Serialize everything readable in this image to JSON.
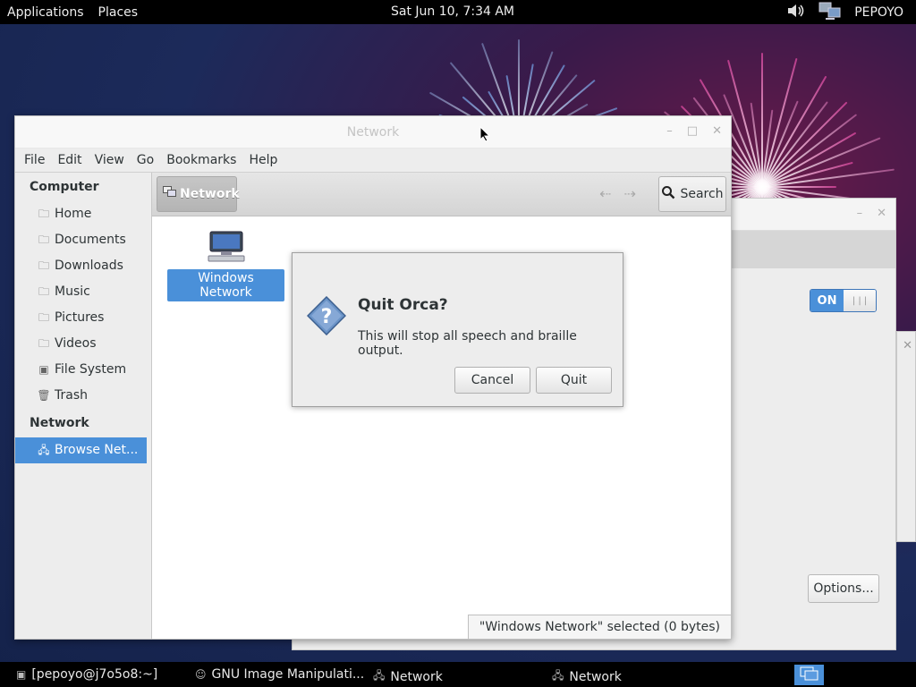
{
  "top_panel": {
    "applications": "Applications",
    "places": "Places",
    "clock": "Sat Jun 10,  7:34 AM",
    "user": "PEPOYO",
    "volume_icon": "speaker-icon",
    "network_icon": "network-icon"
  },
  "main_window": {
    "title": "Network",
    "menu": [
      "File",
      "Edit",
      "View",
      "Go",
      "Bookmarks",
      "Help"
    ],
    "sidebar": {
      "computer_heading": "Computer",
      "computer_items": [
        {
          "label": "Home",
          "icon": "folder-icon"
        },
        {
          "label": "Documents",
          "icon": "folder-icon"
        },
        {
          "label": "Downloads",
          "icon": "folder-icon"
        },
        {
          "label": "Music",
          "icon": "folder-icon"
        },
        {
          "label": "Pictures",
          "icon": "folder-icon"
        },
        {
          "label": "Videos",
          "icon": "folder-icon"
        },
        {
          "label": "File System",
          "icon": "drive-icon"
        },
        {
          "label": "Trash",
          "icon": "trash-icon"
        }
      ],
      "network_heading": "Network",
      "network_items": [
        {
          "label": "Browse Net...",
          "icon": "network-icon",
          "selected": true
        }
      ]
    },
    "toolbar": {
      "location": "Network",
      "search_label": "Search"
    },
    "items": [
      {
        "label": "Windows Network",
        "icon": "windows-network-icon",
        "selected": true
      }
    ],
    "statusbar": "\"Windows Network\" selected (0 bytes)"
  },
  "dialog": {
    "title": "Quit Orca?",
    "message": "This will stop all speech and braille output.",
    "cancel_label": "Cancel",
    "quit_label": "Quit",
    "icon": "question-icon"
  },
  "back_window": {
    "toggle_on": "ON",
    "options_label": "Options..."
  },
  "taskbar": {
    "tasks": [
      {
        "label": "[pepoyo@j7o5o8:~]",
        "icon": "terminal-icon"
      },
      {
        "label": "GNU Image Manipulati...",
        "icon": "gimp-icon"
      },
      {
        "label": "Network",
        "icon": "network-icon"
      },
      {
        "label": "Network",
        "icon": "network-icon"
      }
    ]
  },
  "colors": {
    "accent": "#4a90d9",
    "panel": "#000000"
  }
}
